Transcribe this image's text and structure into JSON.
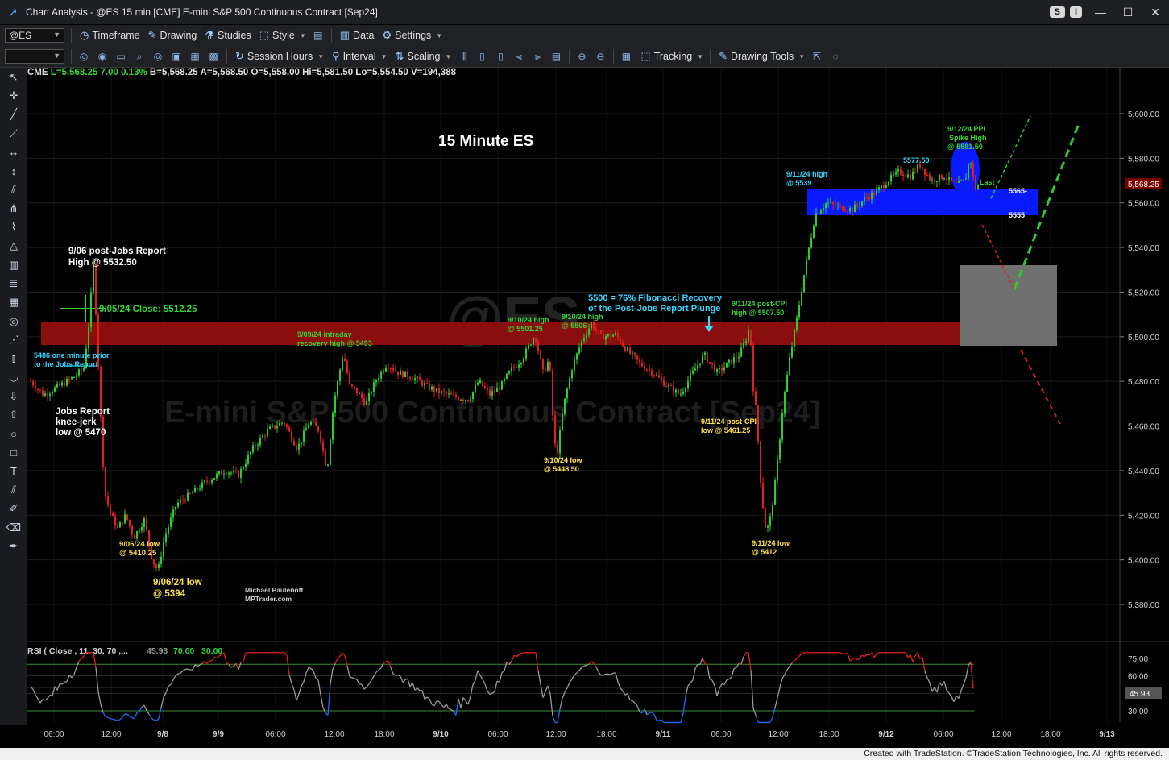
{
  "window": {
    "title": "Chart Analysis - @ES 15 min [CME] E-mini S&P 500 Continuous Contract [Sep24]",
    "pill_s": "S",
    "pill_i": "I"
  },
  "toolbar": {
    "symbol": "@ES",
    "timeframe": "Timeframe",
    "drawing": "Drawing",
    "studies": "Studies",
    "style": "Style",
    "data": "Data",
    "settings": "Settings",
    "session_hours": "Session Hours",
    "interval": "Interval",
    "scaling": "Scaling",
    "tracking": "Tracking",
    "drawing_tools": "Drawing Tools"
  },
  "quote": {
    "exchange": "CME",
    "last": "L=5,568.25",
    "change": "7.00",
    "pct": "0.13%",
    "bid": "B=5,568.25",
    "ask": "A=5,568.50",
    "open": "O=5,558.00",
    "high": "Hi=5,581.50",
    "low": "Lo=5,554.50",
    "volume": "V=194,388"
  },
  "annotations": {
    "chart_title": "15 Minute ES",
    "a1": "9/06 post-Jobs Report",
    "a2": "High @ 5532.50",
    "a3": "9/05/24 Close: 5512.25",
    "a4": "5486 one minute prior",
    "a5": "to the Jobs Report",
    "a6": "Jobs Report",
    "a7": "knee-jerk",
    "a8": "low @ 5470",
    "a9": "9/06/24 low",
    "a10": "@ 5410.25",
    "a11": "9/06/24 low",
    "a12": "@ 5394",
    "a13": "9/09/24 intraday",
    "a14": "recovery high @ 5493",
    "a15": "9/10/24 high",
    "a16": "@ 5501.25",
    "a17": "9/10/24 high",
    "a18": "@ 5506",
    "a19": "5500 = 76% Fibonacci Recovery",
    "a20": "of the Post-Jobs Report Plunge",
    "a21": "9/11/24 post-CPI",
    "a22": "high @ 5507.50",
    "a23": "9/10/24 low",
    "a24": "@ 5448.50",
    "a25": "9/11/24 post-CPI",
    "a26": "low @ 5461.25",
    "a27": "9/11/24 low",
    "a28": "@ 5412",
    "a29": "9/11/24 high",
    "a30": "@ 5539",
    "a31": "5577.50",
    "a32": "9/12/24 PPI",
    "a33": "Spike High",
    "a34": "@ 5581.50",
    "a35": "Last",
    "a36": "5565-",
    "a37": "5555",
    "author1": "Michael Paulenoff",
    "author2": "MPTrader.com",
    "watermark1": "@ES",
    "watermark2": "E-mini S&P 500 Continuous Contract [Sep24]"
  },
  "price_axis": {
    "labels": [
      "5,600.00",
      "5,580.00",
      "5,560.00",
      "5,540.00",
      "5,520.00",
      "5,500.00",
      "5,480.00",
      "5,460.00",
      "5,440.00",
      "5,420.00",
      "5,400.00",
      "5,380.00"
    ],
    "last_price": "5,568.25"
  },
  "rsi": {
    "header_name": "RSI ( Close , 11, 30, 70 ,...",
    "header_value": "45.93",
    "header_ob": "70.00",
    "header_os": "30.00",
    "axis_labels": [
      "75.00",
      "60.00",
      "45.00",
      "30.00"
    ],
    "current": "45.93"
  },
  "time_axis": {
    "labels": [
      "06:00",
      "12:00",
      "9/8",
      "9/9",
      "06:00",
      "12:00",
      "18:00",
      "9/10",
      "06:00",
      "12:00",
      "18:00",
      "9/11",
      "06:00",
      "12:00",
      "18:00",
      "9/12",
      "06:00",
      "12:00",
      "18:00",
      "9/13"
    ]
  },
  "footer": "Created with TradeStation. ©TradeStation Technologies, Inc. All rights reserved.",
  "colors": {
    "up": "#2ecc2e",
    "down": "#e02020",
    "resistance_zone": "#8b0e0e",
    "support_zone": "#0a1aff",
    "target_box": "#707070",
    "annotation_yellow": "#ffe34d",
    "annotation_green": "#37d437",
    "annotation_cyan": "#38d6ff"
  }
}
